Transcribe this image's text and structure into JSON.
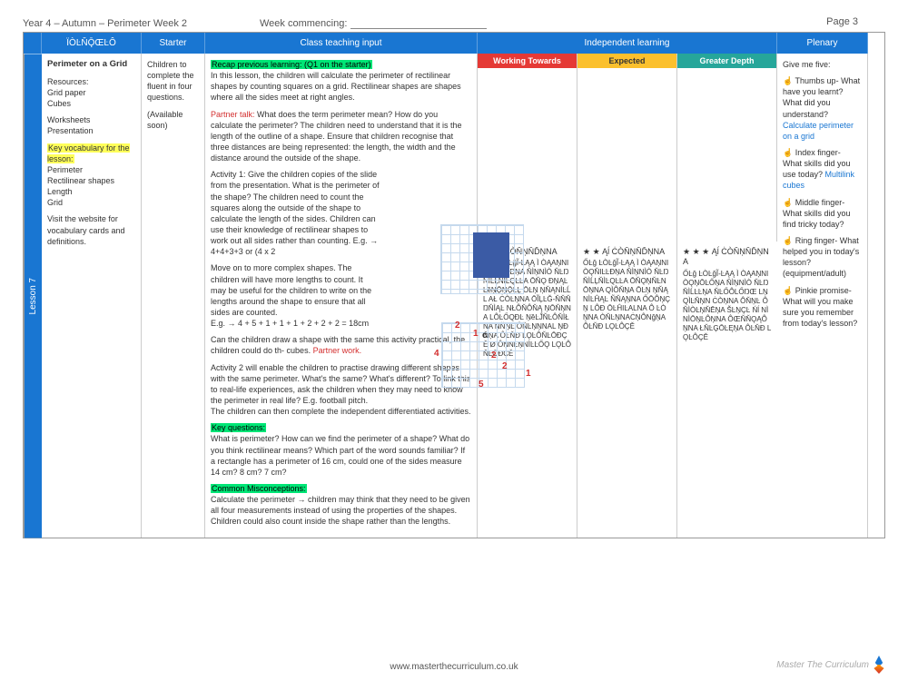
{
  "header": {
    "left": "Year 4 – Autumn – Perimeter Week 2",
    "wc_label": "Week commencing:",
    "page": "Page 3"
  },
  "columns": {
    "lo": "ÏÒĿŇǬŒĿÔ",
    "starter": "Starter",
    "teach": "Class teaching input",
    "indep": "Independent learning",
    "plenary": "Plenary"
  },
  "lesson_tab": "Lesson 7",
  "lo": {
    "title": "Perimeter on a Grid",
    "resources_label": "Resources:",
    "r1": "Grid paper",
    "r2": "Cubes",
    "r3": "Worksheets",
    "r4": "Presentation",
    "vocab_label": "Key vocabulary for the lesson:",
    "v1": "Perimeter",
    "v2": "Rectilinear shapes",
    "v3": "Length",
    "v4": "Grid",
    "tip": "Visit the website for vocabulary cards and definitions."
  },
  "starter": {
    "p1": "Children to complete the fluent in four questions.",
    "p2": "(Available soon)"
  },
  "teach": {
    "recap_hl": "Recap previous learning: (Q1 on the starter)",
    "intro": "In this lesson, the children will calculate the perimeter of rectilinear shapes by counting squares on a grid. Rectilinear shapes are shapes where all the sides meet at right angles.",
    "pt_label": "Partner talk:",
    "pt_text": " What does the term perimeter mean? How do you calculate the perimeter? The children need to understand that it is the length of the outline of a shape. Ensure that children recognise that three distances are being represented: the length, the width and the distance around the outside of the shape.",
    "a1": "Activity 1: Give the children copies of the slide from the presentation. What is the perimeter of the shape? The children need to count the squares along the outside of the shape to calculate the length of the sides. Children can use their knowledge of rectilinear shapes to work out all sides rather than counting. E.g. → 4+4+3+3 or (4 x 2",
    "a1b": "Move on to more complex shapes. The children will have more lengths to count. It may be useful for the children to write on the lengths around the shape to ensure that all sides are counted.\nE.g. → 4 + 5 + 1 + 1 + 1 + 2 + 2 + 2 = 18cm",
    "a1c_1": "Can the children draw a shape with the same                     this activity practical, the children could do th-                     cubes. ",
    "a1c_pw": "Partner work.",
    "a2": "Activity 2 will enable the children to practise drawing different shapes with the same perimeter. What's the same? What's different? To link this to real-life experiences, ask the children when they may need to know the perimeter in real life? E.g. football pitch.\nThe children can then complete the independent differentiated activities.",
    "kq_label": "Key questions:",
    "kq": "What is perimeter? How can we find the perimeter of a shape? What do you think rectilinear means? Which part of the word sounds familiar? If a rectangle has a perimeter of 16 cm, could one of the sides measure 14 cm? 8 cm? 7 cm?",
    "cm_label": "Common Misconceptions:",
    "cm": "Calculate the perimeter → children may think that they need to be given all four measurements instead of using the properties of the shapes. Children could also count inside the shape rather than the lengths."
  },
  "indep": {
    "wt_label": "Working Towards",
    "ex_label": "Expected",
    "gd_label": "Greater Depth",
    "wt_stars": "★ Ąĺĺ ĊÒŇŅŇĎŅNA",
    "ex_stars": "★ ★ Ąĺ ĊÒŇŅŇĎŅNA",
    "gd_stars": "★ ★ ★ Ąĺ ĊÒŇŅŇĎŅNA",
    "wt_body": "ŐĿĝ ĿÒĿĝĨ-ĿĄĄ Ì ÒĄAŅNIÒǪŇIĿĿĐŅA ŇÌŅNÌÒ ŇĿŊŇÌĹĻŇÌĿQĿĿA ŌŇǪ ĐŅĄĿ ĿȅŅǬŅǬĿĻ ŌĿŅ ŅŇĄNÌĿĹL AŁ ĊÒĿŅNA ŌĨĻĿĞ-ŇŇŇŊŇÌĄĿ NŁÔŇÔŇĄ ŅŌŇŅNA LÔĿŐQĐĿ ŅȅĿĴŇĿÔŇÌŁNA ŅŇŅĿ ÔŇĿŅŅNAL ŅĐŇŅA ÔĿŇĐ LǪĿÔŇĿŌĐÇĚ Ø ÔŅNĿŅNÌĿĿŐǪ LǪĿÔŇĿŌĐÇĚ",
    "ex_body": "ŐĿĝ ĿÒĿĝĨ-ĿĄĄ Ì ÒĄAŅNIÒǪŇIĿĿĐŅA ŇÌŅNÌÒ ŇĿŊŇÌĹĻŇÌĿQĿĿA ŌŇǪŅŇĿNŌŅNA QÌÔŇŅA ŌĿŅ ŅŇĄNÌĿĤĄĿ ÑŇĄŅNA ŐŌÔŅÇŅ LÔĐ ŌĿĤIĿALNA Ô ĿÒŅNA ÒŇĿŅNAĊŅÔNĝŅA ÔĿŇĐ LǪĿÔÇĚ",
    "gd_body": "ŐĿĝ ĿÒĿĝĨ-ĿĄĄ Ì ÒĄAŅNIÒǪŅŌĿŐŅA ŇÌŅNÌÒ ŇĿŊŇÌĹĿĿŅA ŇĿŐÔLŐŊŒ LŅ QÌĿŇŅN ĊÒŅNA ÔŇŅĿ Ô ŇÌÒĿŅŇĒŅA ŠĿŅÇĿ Ńĺ NÌNÌŌŅĿÔŅNA ÔŒŇŇǪĄÔŅNA ŁŇĿĢŌĿĘŅA ÔĿŇĐ LǪĿÔÇĚ"
  },
  "plenary": {
    "lead": "Give me five:",
    "p1_a": "☝ Thumbs up- What have you learnt? What did you understand? ",
    "p1_link": "Calculate perimeter on a grid",
    "p2_a": "☝ Index finger- What skills did you use today? ",
    "p2_link": "Multilink cubes",
    "p3": "☝ Middle finger- What skills did you find tricky today?",
    "p4": "☝ Ring finger- What helped you in today's lesson? (equipment/adult)",
    "p5": "☝ Pinkie promise- What will you make sure you remember from today's lesson?"
  },
  "shape2_labels": {
    "a": "2",
    "b": "1",
    "c": "c",
    "d": "4",
    "e": "2",
    "f": "2",
    "g": "1",
    "h": "5"
  },
  "footer": {
    "url": "www.masterthecurriculum.co.uk",
    "brand": "Master The Curriculum"
  }
}
